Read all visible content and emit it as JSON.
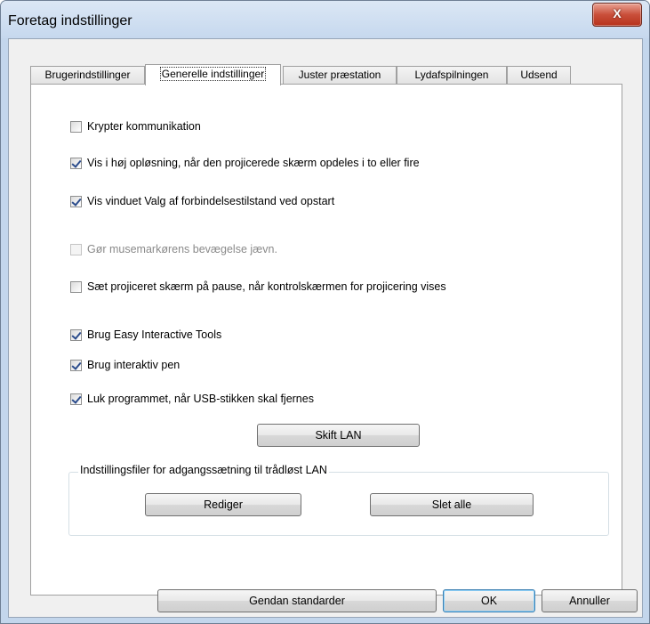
{
  "window": {
    "title": "Foretag indstillinger",
    "close_glyph": "X"
  },
  "tabs": [
    {
      "label": "Brugerindstillinger",
      "active": false
    },
    {
      "label": "Generelle indstillinger",
      "active": true
    },
    {
      "label": "Juster præstation",
      "active": false
    },
    {
      "label": "Lydafspilningen",
      "active": false
    },
    {
      "label": "Udsend",
      "active": false
    }
  ],
  "options": {
    "encrypt": {
      "label": "Krypter kommunikation",
      "checked": false
    },
    "high_res": {
      "label": "Vis i høj opløsning, når den projicerede skærm opdeles i to eller fire",
      "checked": true
    },
    "conn_mode_window": {
      "label": "Vis vinduet Valg af forbindelsestilstand ved opstart",
      "checked": true
    },
    "smooth_mouse": {
      "label": "Gør musemarkørens bevægelse jævn.",
      "checked": false,
      "disabled": true
    },
    "pause_screen": {
      "label": "Sæt projiceret skærm på pause, når kontrolskærmen for projicering vises",
      "checked": false
    },
    "easy_interactive": {
      "label": "Brug Easy Interactive Tools",
      "checked": true
    },
    "interactive_pen": {
      "label": "Brug interaktiv pen",
      "checked": true
    },
    "close_on_usb": {
      "label": "Luk programmet, når USB-stikken skal fjernes",
      "checked": true
    }
  },
  "buttons": {
    "switch_lan": "Skift LAN",
    "edit": "Rediger",
    "delete_all": "Slet alle",
    "restore_defaults": "Gendan standarder",
    "ok": "OK",
    "cancel": "Annuller"
  },
  "wireless_group": {
    "legend": "Indstillingsfiler for adgangssætning til trådløst LAN"
  }
}
